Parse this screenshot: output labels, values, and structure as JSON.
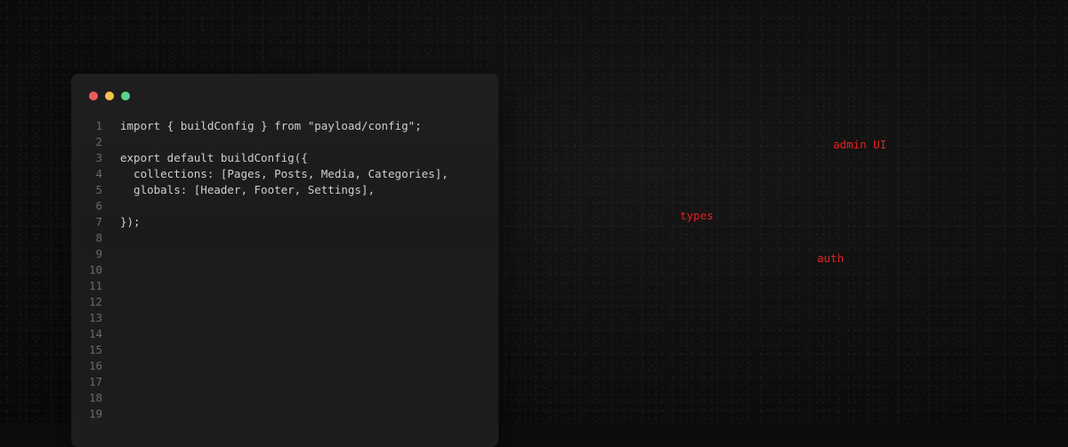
{
  "editor": {
    "window_controls": {
      "close_color": "#ef5a5f",
      "minimize_color": "#f3c24e",
      "maximize_color": "#5bd38b"
    },
    "lines": [
      {
        "num": "1",
        "text": "import { buildConfig } from \"payload/config\";"
      },
      {
        "num": "2",
        "text": ""
      },
      {
        "num": "3",
        "text": "export default buildConfig({"
      },
      {
        "num": "4",
        "text": "  collections: [Pages, Posts, Media, Categories],"
      },
      {
        "num": "5",
        "text": "  globals: [Header, Footer, Settings],"
      },
      {
        "num": "6",
        "text": ""
      },
      {
        "num": "7",
        "text": "});"
      },
      {
        "num": "8",
        "text": ""
      },
      {
        "num": "9",
        "text": ""
      },
      {
        "num": "10",
        "text": ""
      },
      {
        "num": "11",
        "text": ""
      },
      {
        "num": "12",
        "text": ""
      },
      {
        "num": "13",
        "text": ""
      },
      {
        "num": "14",
        "text": ""
      },
      {
        "num": "15",
        "text": ""
      },
      {
        "num": "16",
        "text": ""
      },
      {
        "num": "17",
        "text": ""
      },
      {
        "num": "18",
        "text": ""
      },
      {
        "num": "19",
        "text": ""
      }
    ]
  },
  "floating_labels": {
    "admin_ui": "admin UI",
    "types": "types",
    "auth": "auth",
    "color": "#e5201f"
  }
}
